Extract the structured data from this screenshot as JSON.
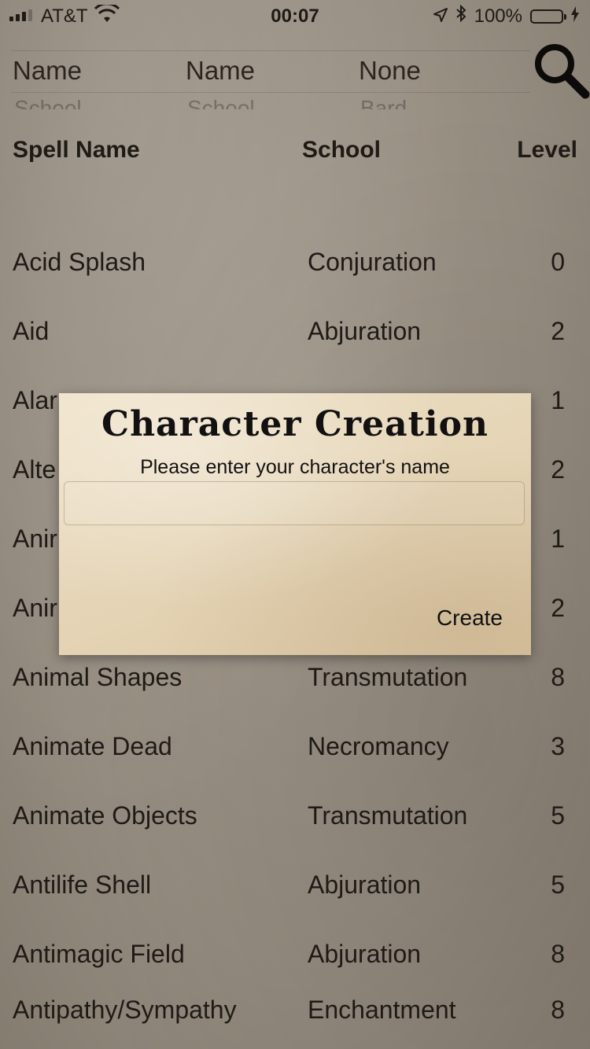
{
  "status_bar": {
    "carrier": "AT&T",
    "time": "00:07",
    "battery": "100%",
    "battery_color": "#4cd964"
  },
  "filters": [
    {
      "selected": "Name",
      "next": "School"
    },
    {
      "selected": "Name",
      "next": "School"
    },
    {
      "selected": "None",
      "next": "Bard"
    }
  ],
  "table": {
    "headers": {
      "name": "Spell Name",
      "school": "School",
      "level": "Level"
    },
    "rows": [
      {
        "name": "Acid Splash",
        "school": "Conjuration",
        "level": "0"
      },
      {
        "name": "Aid",
        "school": "Abjuration",
        "level": "2"
      },
      {
        "name": "Alar",
        "school": "",
        "level": "1"
      },
      {
        "name": "Alte",
        "school": "",
        "level": "2"
      },
      {
        "name": "Anir",
        "school": "",
        "level": "1"
      },
      {
        "name": "Anir",
        "school": "",
        "level": "2"
      },
      {
        "name": "Animal Shapes",
        "school": "Transmutation",
        "level": "8"
      },
      {
        "name": "Animate Dead",
        "school": "Necromancy",
        "level": "3"
      },
      {
        "name": "Animate Objects",
        "school": "Transmutation",
        "level": "5"
      },
      {
        "name": "Antilife Shell",
        "school": "Abjuration",
        "level": "5"
      },
      {
        "name": "Antimagic Field",
        "school": "Abjuration",
        "level": "8"
      },
      {
        "name": "Antipathy/Sympathy",
        "school": "Enchantment",
        "level": "8"
      }
    ]
  },
  "dialog": {
    "title": "Character Creation",
    "message": "Please enter your character's name",
    "input_value": "",
    "button": "Create"
  }
}
